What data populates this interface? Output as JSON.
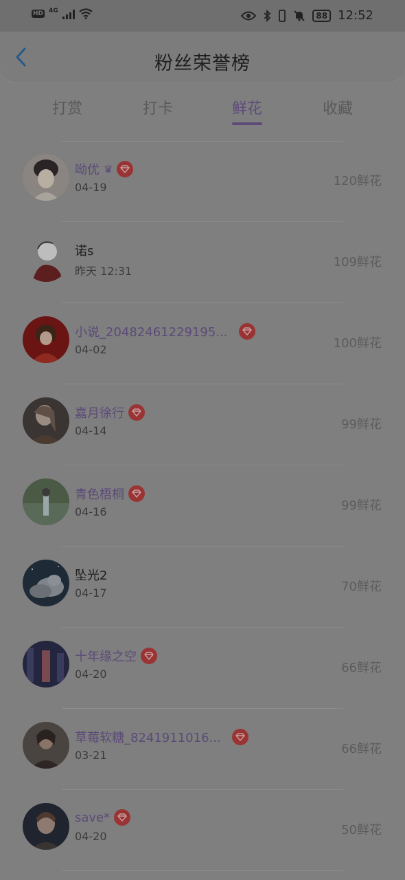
{
  "status_bar": {
    "hd": "HD",
    "network": "4G",
    "battery": "88",
    "time": "12:52"
  },
  "header": {
    "title": "粉丝荣誉榜"
  },
  "tabs": [
    {
      "label": "打赏",
      "active": false
    },
    {
      "label": "打卡",
      "active": false
    },
    {
      "label": "鲜花",
      "active": true
    },
    {
      "label": "收藏",
      "active": false
    }
  ],
  "fans": [
    {
      "name": "呦优",
      "crown": "♛",
      "vip": true,
      "date": "04-19",
      "amount": "120鲜花"
    },
    {
      "name": "诺s",
      "crown": "",
      "vip": false,
      "date": "昨天 12:31",
      "amount": "109鲜花"
    },
    {
      "name": "小说_20482461229195...",
      "crown": "",
      "vip": true,
      "date": "04-02",
      "amount": "100鲜花"
    },
    {
      "name": "嘉月徐行",
      "crown": "",
      "vip": true,
      "date": "04-14",
      "amount": "99鲜花"
    },
    {
      "name": "青色梧桐",
      "crown": "",
      "vip": true,
      "date": "04-16",
      "amount": "99鲜花"
    },
    {
      "name": "坠光2",
      "crown": "",
      "vip": false,
      "date": "04-17",
      "amount": "70鲜花"
    },
    {
      "name": "十年缘之空",
      "crown": "",
      "vip": true,
      "date": "04-20",
      "amount": "66鲜花"
    },
    {
      "name": "草莓软糖_8241911016...",
      "crown": "",
      "vip": true,
      "date": "03-21",
      "amount": "66鲜花"
    },
    {
      "name": "save*",
      "crown": "",
      "vip": true,
      "date": "04-20",
      "amount": "50鲜花"
    }
  ],
  "colors": {
    "accent": "#5c4a78",
    "vip_badge": "#9a3434",
    "overlay_bg": "#7f7f7f"
  }
}
